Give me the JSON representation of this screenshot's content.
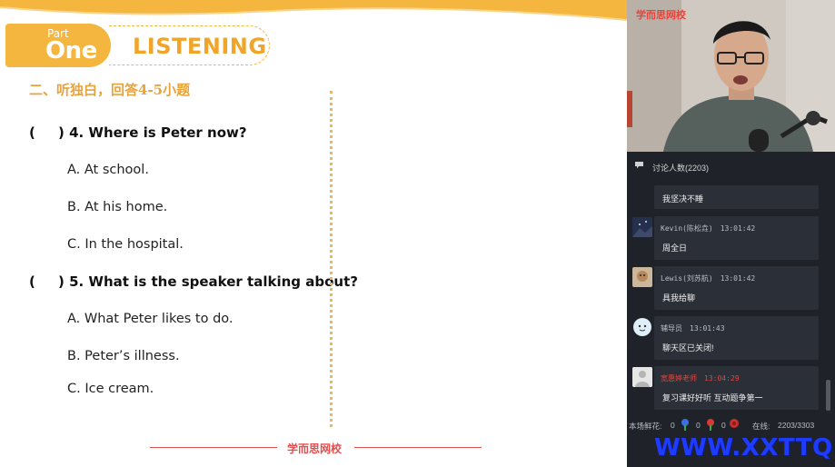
{
  "slide": {
    "part_small": "Part",
    "part_big": "One",
    "section_title": "LISTENING",
    "instruction": "二、听独白，回答4-5小题",
    "questions": [
      {
        "paren": "(",
        "stem": ") 4. Where is Peter now?",
        "options": [
          "A. At school.",
          "B. At his home.",
          "C. In the hospital."
        ]
      },
      {
        "paren": "(",
        "stem": ") 5. What is the speaker talking about?",
        "options": [
          "A. What Peter likes to do.",
          "B. Peter’s illness.",
          "C. Ice cream."
        ]
      }
    ],
    "footer_brand": "学而思网校"
  },
  "video": {
    "brand": "学而思网校"
  },
  "chat": {
    "icon": "chat-bubble-icon",
    "title": "讨论人数(2203)",
    "messages": [
      {
        "user": "",
        "time": "",
        "text": "我坚决不睡",
        "user_color": "#b9bec6"
      },
      {
        "user": "Kevin(陈松垚)",
        "time": "13:01:42",
        "text": "周全日",
        "user_color": "#b9bec6"
      },
      {
        "user": "Lewis(刘苏航)",
        "time": "13:01:42",
        "text": "具我给聊",
        "user_color": "#b9bec6"
      },
      {
        "user": "辅导员",
        "time": "13:01:43",
        "text": "聊天区已关闭!",
        "user_color": "#b9bec6"
      },
      {
        "user": "宽惠婷老师",
        "time": "13:04:29",
        "text": "复习课好好听 互动题争第一",
        "user_color": "#e8433a"
      }
    ]
  },
  "stats": {
    "flowers_label": "本场鲜花:",
    "count_a": "0",
    "count_b": "0",
    "count_c": "0",
    "online_label": "在线:",
    "online_count": "2203/3303"
  },
  "watermark": "WWW.XXTTQ.COM",
  "colors": {
    "accent_orange": "#f4b63e",
    "brand_red": "#e34f4f",
    "panel_bg": "#1f2228",
    "watermark_blue": "#1e3cff"
  }
}
